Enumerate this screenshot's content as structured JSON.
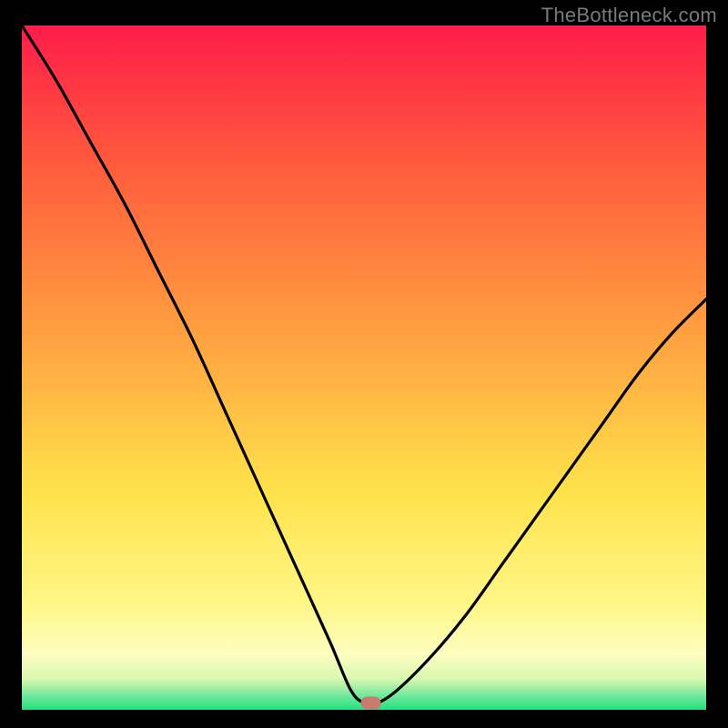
{
  "watermark": "TheBottleneck.com",
  "chart_data": {
    "type": "line",
    "title": "",
    "xlabel": "",
    "ylabel": "",
    "xlim": [
      0,
      100
    ],
    "ylim": [
      0,
      100
    ],
    "series": [
      {
        "name": "curve",
        "x": [
          0,
          5,
          10,
          15,
          20,
          25,
          30,
          35,
          40,
          45,
          48,
          50,
          52,
          55,
          60,
          65,
          70,
          75,
          80,
          85,
          90,
          95,
          100
        ],
        "y": [
          100,
          92,
          83,
          74,
          64,
          54,
          43,
          32,
          21,
          10,
          3,
          1,
          1,
          3,
          8,
          14,
          21,
          28,
          35,
          42,
          49,
          55,
          60
        ]
      }
    ],
    "marker": {
      "x": 51,
      "y": 1
    },
    "background_gradient": {
      "stops": [
        {
          "offset": 0.0,
          "color": "#ff1c4a"
        },
        {
          "offset": 0.2,
          "color": "#ff5a3c"
        },
        {
          "offset": 0.45,
          "color": "#ffa040"
        },
        {
          "offset": 0.68,
          "color": "#ffe24a"
        },
        {
          "offset": 0.85,
          "color": "#fff78a"
        },
        {
          "offset": 0.92,
          "color": "#fdfec0"
        },
        {
          "offset": 0.955,
          "color": "#d8f7b0"
        },
        {
          "offset": 0.98,
          "color": "#6fe89b"
        },
        {
          "offset": 1.0,
          "color": "#25e07f"
        }
      ]
    }
  }
}
